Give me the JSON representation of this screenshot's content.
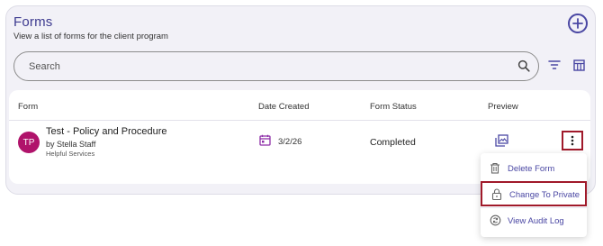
{
  "header": {
    "title": "Forms",
    "subtitle": "View a list of forms for the client program"
  },
  "search": {
    "placeholder": "Search"
  },
  "table": {
    "columns": [
      "Form",
      "Date Created",
      "Form Status",
      "Preview"
    ],
    "rows": [
      {
        "avatar_initials": "TP",
        "form_name": "Test - Policy and Procedure",
        "author": "by Stella Staff",
        "organization": "Helpful Services",
        "date_created": "3/2/26",
        "status": "Completed"
      }
    ]
  },
  "menu": {
    "items": [
      {
        "label": "Delete Form",
        "icon": "trash-icon"
      },
      {
        "label": "Change To Private",
        "icon": "lock-icon"
      },
      {
        "label": "View Audit Log",
        "icon": "audit-log-icon"
      }
    ]
  },
  "colors": {
    "accent": "#4a47a3",
    "avatar": "#b0136b",
    "highlight": "#a0192a",
    "background": "#f2f1f7"
  }
}
